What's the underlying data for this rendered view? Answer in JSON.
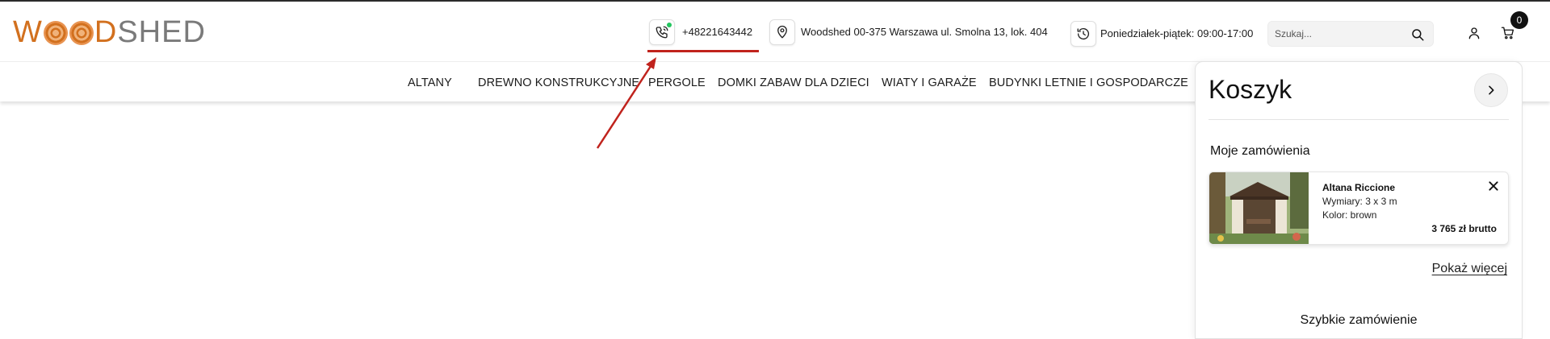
{
  "header": {
    "logo": {
      "part1": "W",
      "part2": "D",
      "part3": "SHED"
    },
    "phone": "+48221643442",
    "address": "Woodshed 00-375 Warszawa ul. Smolna 13, lok. 404",
    "hours": "Poniedziałek-piątek: 09:00-17:00",
    "search_placeholder": "Szukaj...",
    "cart_count": "0"
  },
  "nav": {
    "items": [
      "ALTANY",
      "DREWNO KONSTRUKCYJNE",
      "PERGOLE",
      "DOMKI ZABAW DLA DZIECI",
      "WIATY I GARAŻE",
      "BUDYNKI LETNIE I GOSPODARCZE"
    ]
  },
  "cart": {
    "title": "Koszyk",
    "orders_label": "Moje zamówienia",
    "items": [
      {
        "name": "Altana Riccione",
        "dimensions": "Wymiary: 3 x 3 m",
        "color": "Kolor: brown",
        "price": "3 765 zł brutto"
      }
    ],
    "more_link": "Pokaż więcej",
    "quick_order": "Szybkie zamówienie"
  },
  "colors": {
    "brand_orange": "#d2701e",
    "brand_gray": "#7a7a7a",
    "annotation_red": "#c0231d",
    "online_green": "#22c55e"
  },
  "icons": [
    "phone-icon",
    "location-pin-icon",
    "clock-icon",
    "search-icon",
    "user-icon",
    "cart-icon",
    "chevron-right-icon",
    "close-icon"
  ]
}
